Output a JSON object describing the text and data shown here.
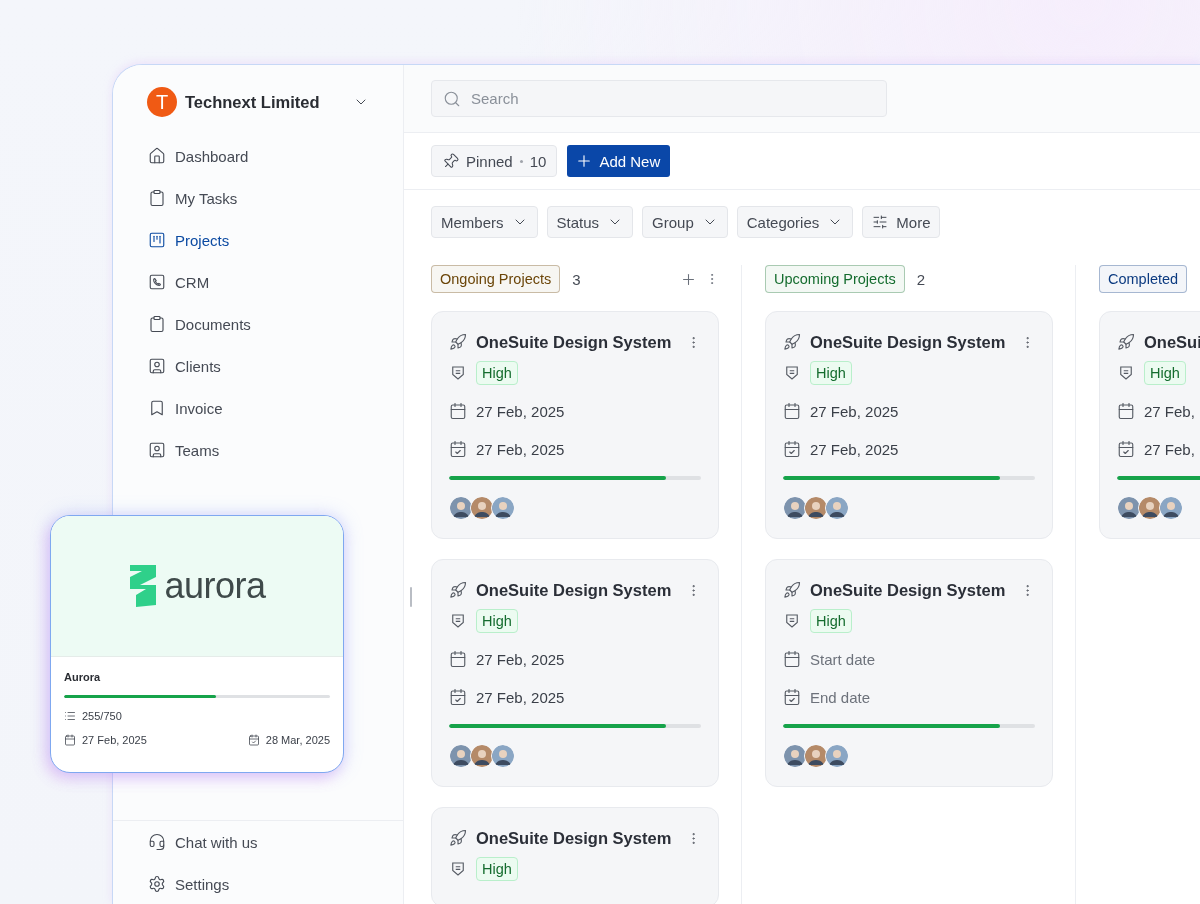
{
  "org": {
    "initial": "T",
    "name": "Technext Limited"
  },
  "nav": [
    {
      "label": "Dashboard",
      "selected": false
    },
    {
      "label": "My Tasks",
      "selected": false
    },
    {
      "label": "Projects",
      "selected": true
    },
    {
      "label": "CRM",
      "selected": false
    },
    {
      "label": "Documents",
      "selected": false
    },
    {
      "label": "Clients",
      "selected": false
    },
    {
      "label": "Invoice",
      "selected": false
    },
    {
      "label": "Teams",
      "selected": false
    }
  ],
  "footer_nav": [
    {
      "label": "Chat with us"
    },
    {
      "label": "Settings"
    }
  ],
  "search": {
    "placeholder": "Search"
  },
  "pinned": {
    "label": "Pinned",
    "count": "10"
  },
  "add_button": "Add New",
  "filters": [
    {
      "label": "Members",
      "kind": "dropdown"
    },
    {
      "label": "Status",
      "kind": "dropdown"
    },
    {
      "label": "Group",
      "kind": "dropdown"
    },
    {
      "label": "Categories",
      "kind": "dropdown"
    },
    {
      "label": "More",
      "kind": "options"
    }
  ],
  "columns": [
    {
      "title": "Ongoing Projects",
      "count": "3",
      "color": "#6b4508",
      "actions": true,
      "cards": [
        {
          "title": "OneSuite Design System",
          "menu": true,
          "priority": "High",
          "start": {
            "text": "27 Feb, 2025",
            "empty": false
          },
          "end": {
            "text": "27 Feb, 2025",
            "empty": false
          },
          "level": 0.86,
          "members": [
            {
              "kind": "picture"
            },
            {
              "kind": "picture"
            },
            {
              "kind": "picture"
            }
          ]
        },
        {
          "title": "OneSuite Design System",
          "menu": true,
          "priority": "High",
          "start": {
            "text": "27 Feb, 2025",
            "empty": false
          },
          "end": {
            "text": "27 Feb, 2025",
            "empty": false
          },
          "level": 0.86,
          "members": [
            {
              "kind": "picture"
            },
            {
              "kind": "picture"
            },
            {
              "kind": "picture"
            }
          ]
        },
        {
          "title": "OneSuite Design System",
          "menu": true,
          "priority": "High"
        }
      ]
    },
    {
      "title": "Upcoming Projects",
      "count": "2",
      "color": "#146c2e",
      "actions": false,
      "cards": [
        {
          "title": "OneSuite Design System",
          "menu": true,
          "priority": "High",
          "start": {
            "text": "27 Feb, 2025",
            "empty": false
          },
          "end": {
            "text": "27 Feb, 2025",
            "empty": false
          },
          "level": 0.86,
          "members": [
            {
              "kind": "picture"
            },
            {
              "kind": "picture"
            },
            {
              "kind": "picture"
            }
          ]
        },
        {
          "title": "OneSuite Design System",
          "menu": true,
          "priority": "High",
          "start": {
            "text": "Start date",
            "empty": true
          },
          "end": {
            "text": "End date",
            "empty": true
          },
          "level": 0.86,
          "members": [
            {
              "kind": "picture"
            },
            {
              "kind": "picture"
            },
            {
              "kind": "picture"
            }
          ]
        }
      ]
    },
    {
      "title": "Completed",
      "color": "#0b3a80",
      "cards": [
        {
          "title": "OneSui",
          "priority": "High",
          "start": {
            "text": "27 Feb,",
            "empty": false
          },
          "end": {
            "text": "27 Feb,",
            "empty": false
          },
          "level": 0.86,
          "members": [
            {
              "kind": "picture"
            },
            {
              "kind": "picture"
            },
            {
              "kind": "picture"
            }
          ]
        }
      ]
    }
  ],
  "promo_card": {
    "logo_text": "aurora",
    "title": "Aurora",
    "level": 0.57,
    "tasks": "255/750",
    "start": "27 Feb, 2025",
    "end": "28 Mar, 2025"
  }
}
